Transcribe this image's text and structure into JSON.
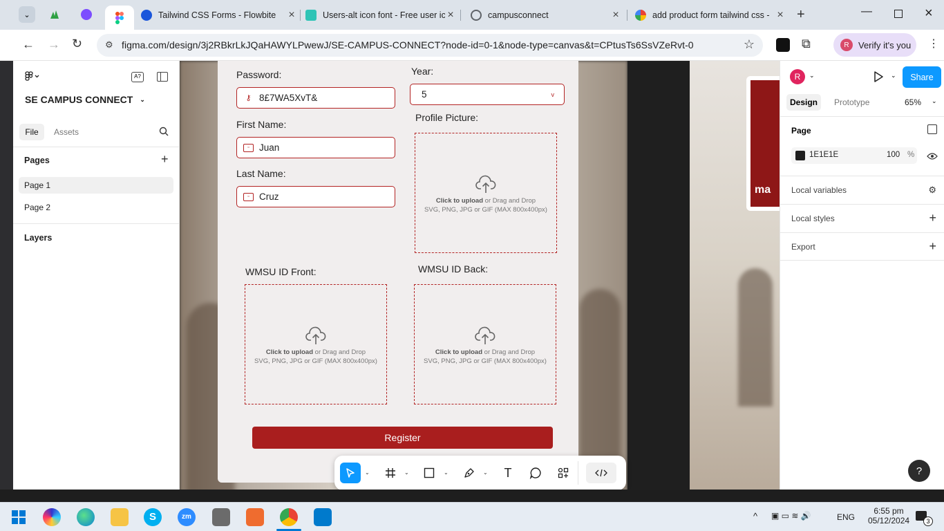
{
  "browser": {
    "tabs": [
      {
        "title": "Tailwind CSS Forms - Flowbite",
        "color": "#1a56db"
      },
      {
        "title": "Users-alt icon font - Free user ic",
        "color": "#2ec4b6"
      },
      {
        "title": "campusconnect",
        "color": "#5f6368"
      },
      {
        "title": "add product form tailwind css -",
        "color": "#4285f4"
      }
    ],
    "url": "figma.com/design/3j2RBkrLkJQaHAWYLPwewJ/SE-CAMPUS-CONNECT?node-id=0-1&node-type=canvas&t=CPtusTs6SsVZeRvt-0",
    "verify_label": "Verify it's you",
    "profile_initial": "R"
  },
  "figma": {
    "project_name": "SE CAMPUS CONNECT",
    "tabs": {
      "file": "File",
      "assets": "Assets"
    },
    "pages_header": "Pages",
    "pages": [
      "Page 1",
      "Page 2"
    ],
    "layers_header": "Layers",
    "right": {
      "avatar": "R",
      "share": "Share",
      "design_tab": "Design",
      "prototype_tab": "Prototype",
      "zoom": "65%",
      "page_header": "Page",
      "bg_color": "1E1E1E",
      "opacity": "100",
      "percent": "%",
      "local_variables": "Local variables",
      "local_styles": "Local styles",
      "export": "Export",
      "help": "?"
    }
  },
  "form": {
    "password_label": "Password:",
    "password_value": "8£7WA5XvT&",
    "year_label": "Year:",
    "year_value": "5",
    "first_name_label": "First Name:",
    "first_name_value": "Juan",
    "last_name_label": "Last Name:",
    "last_name_value": "Cruz",
    "profile_picture_label": "Profile Picture:",
    "id_front_label": "WMSU ID Front:",
    "id_back_label": "WMSU ID Back:",
    "upload_bold": "Click to upload",
    "upload_rest": " or Drag and Drop",
    "upload_formats": "SVG, PNG, JPG or GIF (MAX 800x400px)",
    "register": "Register"
  },
  "system": {
    "time": "6:55 pm",
    "date": "05/12/2024",
    "lang": "ENG",
    "notif": "3"
  }
}
